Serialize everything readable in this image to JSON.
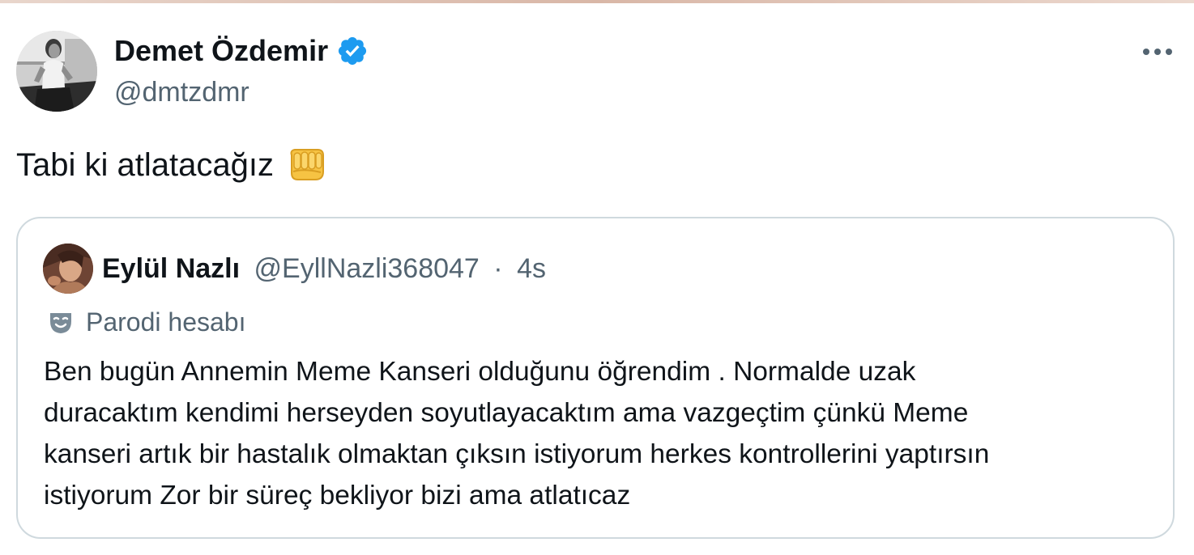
{
  "tweet": {
    "author": {
      "name": "Demet Özdemir",
      "handle": "@dmtzdmr",
      "verified": true,
      "avatar_icon": "profile-photo"
    },
    "text": "Tabi ki atlatacağız",
    "emoji_icon": "oncoming-fist-emoji",
    "more_icon": "more-options-icon"
  },
  "quote": {
    "author": {
      "name": "Eylül Nazlı",
      "handle": "@EyllNazli368047",
      "separator": "·",
      "time": "4s",
      "avatar_icon": "profile-photo"
    },
    "label": "Parodi hesabı",
    "label_icon": "theater-mask-icon",
    "body_lines": [
      "Ben bugün Annemin Meme Kanseri olduğunu öğrendim . Normalde uzak",
      "duracaktım kendimi herseyden soyutlayacaktım ama vazgeçtim çünkü  Meme",
      "kanseri artık bir hastalık olmaktan çıksın istiyorum herkes kontrollerini yaptırsın",
      "istiyorum Zor bir süreç bekliyor bizi ama atlatıcaz"
    ]
  },
  "colors": {
    "text_primary": "#0f1419",
    "text_secondary": "#536471",
    "verified_blue": "#1d9bf0",
    "border": "#cfd9de"
  }
}
